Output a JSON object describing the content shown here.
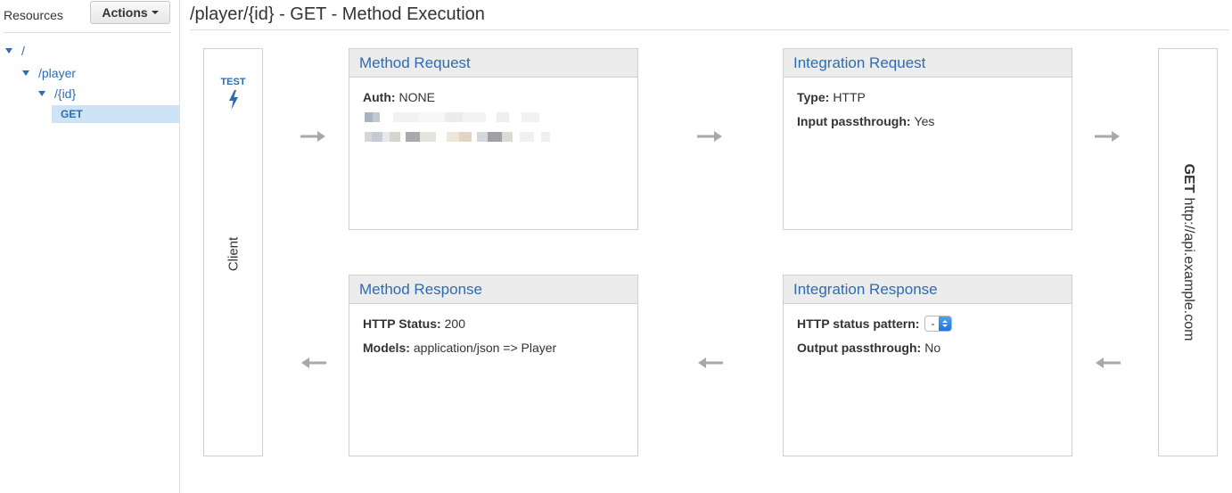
{
  "sidebar": {
    "title": "Resources",
    "actions_label": "Actions",
    "tree": [
      {
        "label": "/"
      },
      {
        "label": "/player"
      },
      {
        "label": "/{id}"
      }
    ],
    "selected_method": "GET"
  },
  "page": {
    "title": "/player/{id} - GET - Method Execution"
  },
  "client": {
    "test_label": "TEST",
    "label": "Client"
  },
  "endpoint": {
    "method": "GET",
    "url": "http://api.example.com"
  },
  "method_request": {
    "title": "Method Request",
    "auth_key": "Auth:",
    "auth_value": "NONE"
  },
  "integration_request": {
    "title": "Integration Request",
    "type_key": "Type:",
    "type_value": "HTTP",
    "passthrough_key": "Input passthrough:",
    "passthrough_value": "Yes"
  },
  "method_response": {
    "title": "Method Response",
    "status_key": "HTTP Status:",
    "status_value": "200",
    "models_key": "Models:",
    "models_value": "application/json => Player"
  },
  "integration_response": {
    "title": "Integration Response",
    "pattern_key": "HTTP status pattern:",
    "pattern_value": "-",
    "passthrough_key": "Output passthrough:",
    "passthrough_value": "No"
  },
  "colors": {
    "link": "#2e6bb0",
    "panel_header": "#ececec",
    "border": "#cfcfcf",
    "selected_bg": "#cfe3f6",
    "arrow": "#a8a8a8"
  }
}
